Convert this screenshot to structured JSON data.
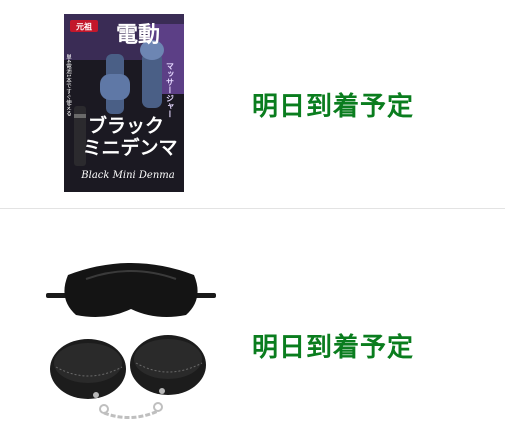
{
  "items": [
    {
      "delivery_text": "明日到着予定",
      "product_art": {
        "badge": "元祖",
        "vertical_caption": "単4電池1本ですぐ使える",
        "headline": "電動",
        "subhead": "マッサージャー",
        "title_line1": "ブラック",
        "title_line2": "ミニデンマ",
        "script_title": "Black Mini Denma"
      }
    },
    {
      "delivery_text": "明日到着予定"
    }
  ],
  "colors": {
    "delivery_text": "#0a7d1e",
    "divider": "#e3e3e3",
    "package_dark": "#1b1922",
    "package_purple": "#5c3f86"
  }
}
